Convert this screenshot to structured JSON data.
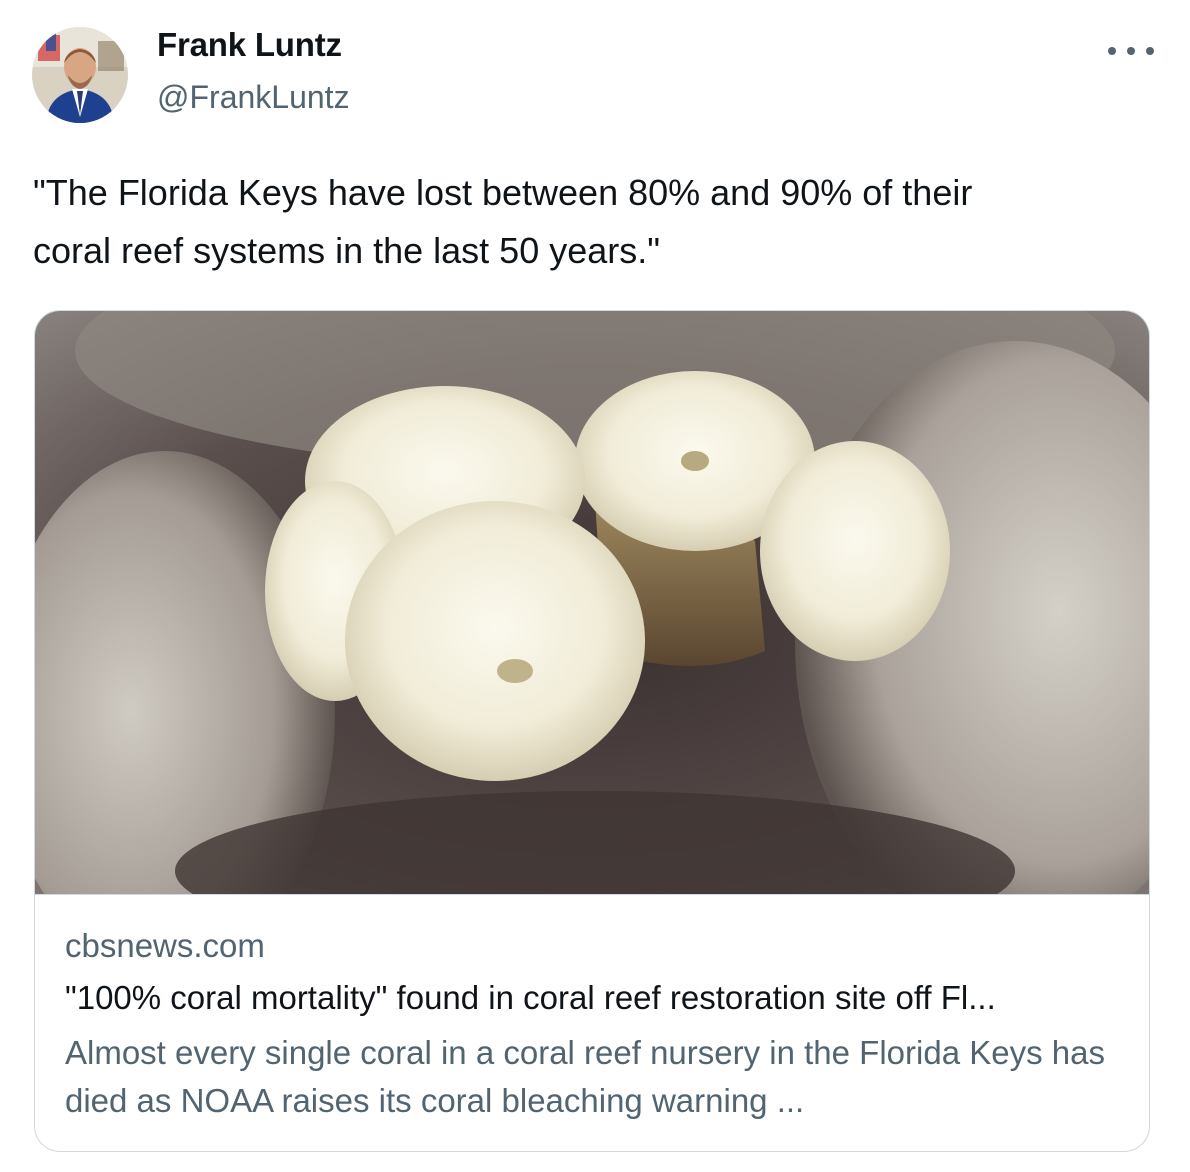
{
  "author": {
    "name": "Frank Luntz",
    "handle": "@FrankLuntz",
    "avatar_icon": "profile-photo"
  },
  "more_icon": "ellipsis-icon",
  "tweet": {
    "text": "\"The Florida Keys have lost between 80% and 90% of their\ncoral reef systems in the last 50 years.\""
  },
  "card": {
    "image_icon": "coral-photo",
    "domain": "cbsnews.com",
    "title": "\"100% coral mortality\" found in coral reef restoration site off Fl...",
    "description": "Almost every single coral in a coral reef nursery in the Florida Keys has died as NOAA raises its coral bleaching warning ..."
  },
  "colors": {
    "text": "#0f1419",
    "secondary": "#536471",
    "border": "#cfd9de"
  }
}
